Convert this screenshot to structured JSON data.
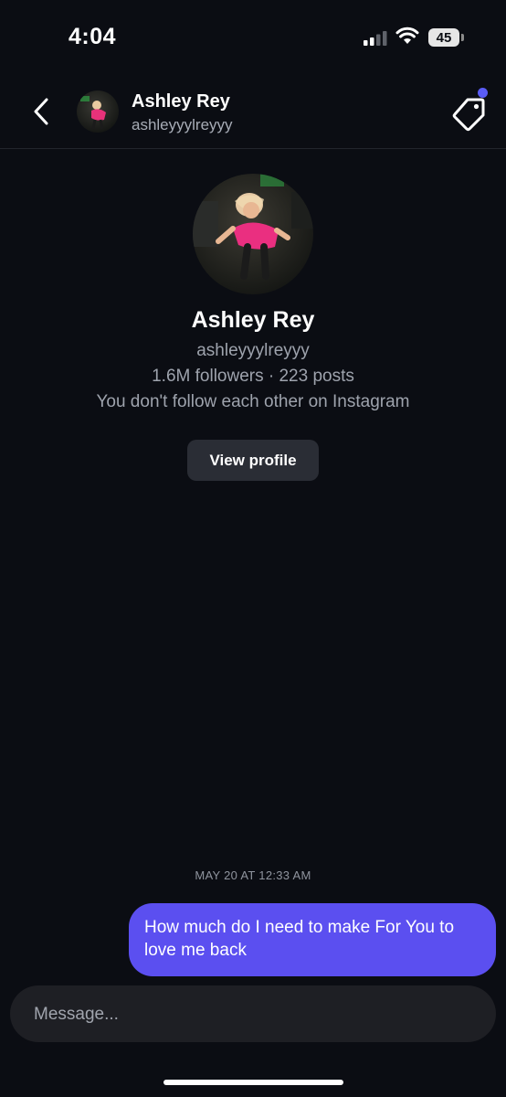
{
  "status_bar": {
    "time": "4:04",
    "battery": "45",
    "icons": [
      "cellular-signal-icon",
      "wifi-icon",
      "battery-icon"
    ]
  },
  "header": {
    "name": "Ashley Rey",
    "handle": "ashleyyylreyyy",
    "icons": [
      "chevron-left-icon",
      "tag-icon"
    ],
    "notification_dot_color": "#5a5cf6"
  },
  "profile": {
    "name": "Ashley Rey",
    "handle": "ashleyyylreyyy",
    "stats": "1.6M followers · 223 posts",
    "relation": "You don't follow each other on Instagram",
    "button_label": "View profile"
  },
  "conversation": {
    "timestamp": "MAY 20 AT 12:33 AM",
    "messages": [
      {
        "from": "me",
        "text": "How much do I need to make For You to love me back"
      }
    ],
    "sent_bubble_color": "#5b4ff0"
  },
  "composer": {
    "placeholder": "Message..."
  },
  "colors": {
    "background": "#0b0d13",
    "accent": "#5a5cf6"
  }
}
